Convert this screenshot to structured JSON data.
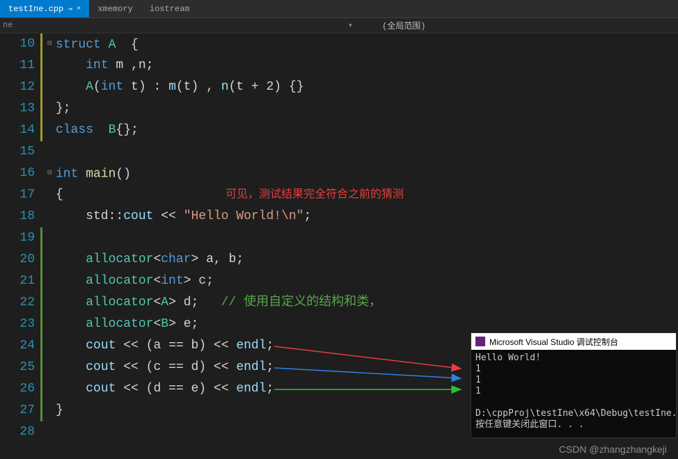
{
  "tabs": {
    "active": "testIne.cpp",
    "other1": "xmemory",
    "other2": "iostream",
    "pin_glyph": "⇥",
    "close_glyph": "×"
  },
  "scope": {
    "left": "ne",
    "dropdown_glyph": "▾",
    "right": "(全局范围)"
  },
  "lines": {
    "10": "10",
    "11": "11",
    "12": "12",
    "13": "13",
    "14": "14",
    "15": "15",
    "16": "16",
    "17": "17",
    "18": "18",
    "19": "19",
    "20": "20",
    "21": "21",
    "22": "22",
    "23": "23",
    "24": "24",
    "25": "25",
    "26": "26",
    "27": "27",
    "28": "28"
  },
  "code": {
    "l10": {
      "fold": "⊟",
      "kw": "struct",
      "type": "A",
      "rest": "  {"
    },
    "l11": {
      "kw": "int",
      "vars": " m ,n;"
    },
    "l12": {
      "ctor": "A",
      "p1": "(",
      "kw": "int",
      "t": " t) : ",
      "m": "m",
      "mt": "(t) , ",
      "n": "n",
      "nt": "(t + 2) {}"
    },
    "l13": {
      "txt": "};"
    },
    "l14": {
      "kw": "class",
      "type": "  B",
      "rest": "{};"
    },
    "l15": {
      "txt": ""
    },
    "l16": {
      "fold": "⊟",
      "kw": "int",
      "func": " main",
      "paren": "()"
    },
    "l17": {
      "txt": "{"
    },
    "l18": {
      "pre": "    std::",
      "cout": "cout",
      "op": " << ",
      "str": "\"Hello World!\\n\"",
      "end": ";"
    },
    "l19": {
      "txt": ""
    },
    "l20": {
      "ind": "    ",
      "type": "allocator",
      "tpl1": "<",
      "tpar": "char",
      "tpl2": "> ",
      "vars": "a, b;"
    },
    "l21": {
      "ind": "    ",
      "type": "allocator",
      "tpl1": "<",
      "tpar": "int",
      "tpl2": "> ",
      "vars": "c;"
    },
    "l22": {
      "ind": "    ",
      "type": "allocator",
      "tpl1": "<",
      "tpar": "A",
      "tpl2": "> ",
      "vars": "d;",
      "cmt": "   // 使用自定义的结构和类，"
    },
    "l23": {
      "ind": "    ",
      "type": "allocator",
      "tpl1": "<",
      "tpar": "B",
      "tpl2": "> ",
      "vars": "e;"
    },
    "l24": {
      "ind": "    ",
      "cout": "cout",
      "op1": " << (",
      "a": "a",
      "eq": " == ",
      "b": "b",
      "op2": ") << ",
      "endl": "endl",
      "end": ";"
    },
    "l25": {
      "ind": "    ",
      "cout": "cout",
      "op1": " << (",
      "a": "c",
      "eq": " == ",
      "b": "d",
      "op2": ") << ",
      "endl": "endl",
      "end": ";"
    },
    "l26": {
      "ind": "    ",
      "cout": "cout",
      "op1": " << (",
      "a": "d",
      "eq": " == ",
      "b": "e",
      "op2": ") << ",
      "endl": "endl",
      "end": ";"
    },
    "l27": {
      "txt": "}"
    },
    "l28": {
      "txt": ""
    }
  },
  "annotation": "可见，测试结果完全符合之前的猜测",
  "console": {
    "title": "Microsoft Visual Studio 调试控制台",
    "out1": "Hello World!",
    "out2": "1",
    "out3": "1",
    "out4": "1",
    "out5": "",
    "out6": "D:\\cppProj\\testIne\\x64\\Debug\\testIne.",
    "out7": "按任意键关闭此窗口. . ."
  },
  "watermark": "CSDN @zhangzhangkeji"
}
